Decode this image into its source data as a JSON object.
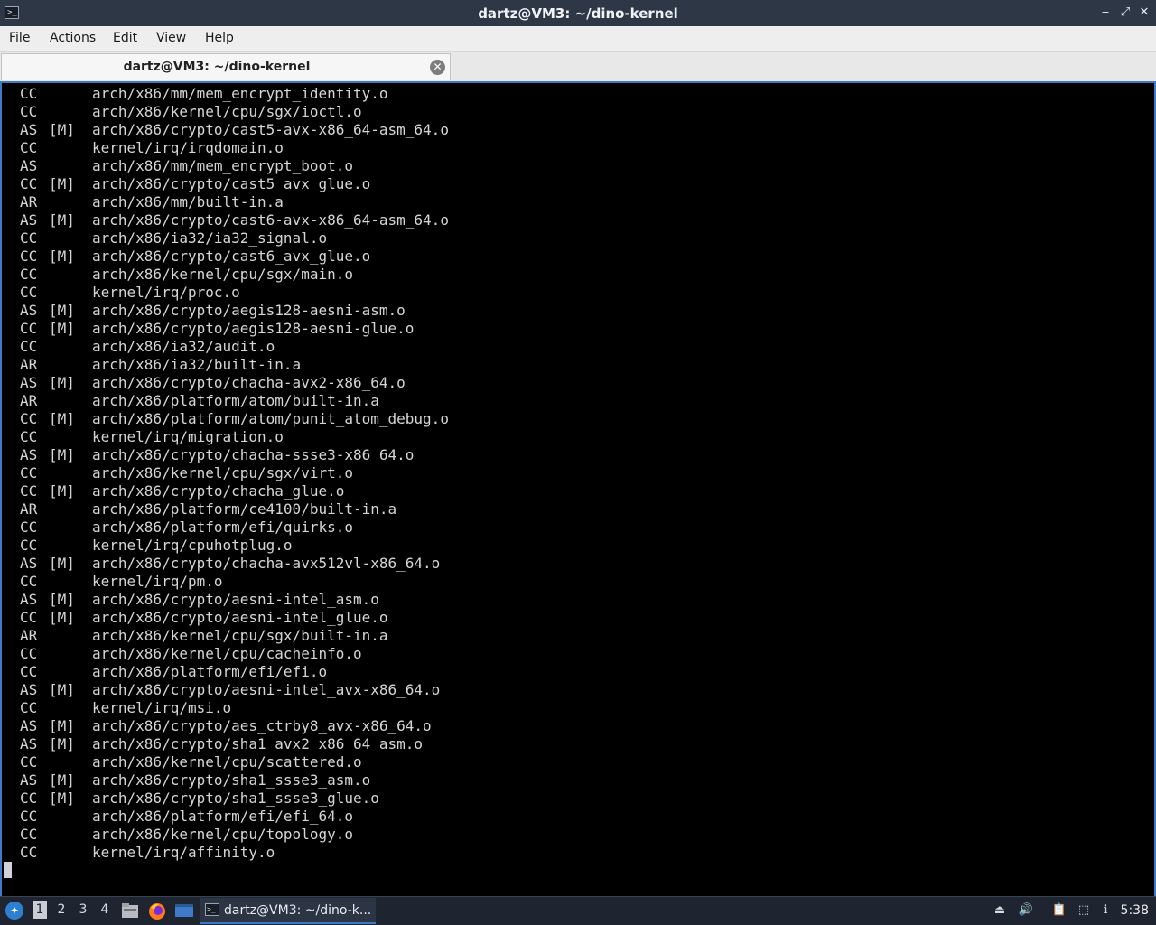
{
  "window": {
    "title": "dartz@VM3: ~/dino-kernel"
  },
  "menubar": {
    "items": [
      "File",
      "Actions",
      "Edit",
      "View",
      "Help"
    ]
  },
  "tab": {
    "label": "dartz@VM3: ~/dino-kernel"
  },
  "terminal": {
    "lines": [
      [
        "CC",
        "",
        "arch/x86/mm/mem_encrypt_identity.o"
      ],
      [
        "CC",
        "",
        "arch/x86/kernel/cpu/sgx/ioctl.o"
      ],
      [
        "AS",
        "[M]",
        "arch/x86/crypto/cast5-avx-x86_64-asm_64.o"
      ],
      [
        "CC",
        "",
        "kernel/irq/irqdomain.o"
      ],
      [
        "AS",
        "",
        "arch/x86/mm/mem_encrypt_boot.o"
      ],
      [
        "CC",
        "[M]",
        "arch/x86/crypto/cast5_avx_glue.o"
      ],
      [
        "AR",
        "",
        "arch/x86/mm/built-in.a"
      ],
      [
        "AS",
        "[M]",
        "arch/x86/crypto/cast6-avx-x86_64-asm_64.o"
      ],
      [
        "CC",
        "",
        "arch/x86/ia32/ia32_signal.o"
      ],
      [
        "CC",
        "[M]",
        "arch/x86/crypto/cast6_avx_glue.o"
      ],
      [
        "CC",
        "",
        "arch/x86/kernel/cpu/sgx/main.o"
      ],
      [
        "CC",
        "",
        "kernel/irq/proc.o"
      ],
      [
        "AS",
        "[M]",
        "arch/x86/crypto/aegis128-aesni-asm.o"
      ],
      [
        "CC",
        "[M]",
        "arch/x86/crypto/aegis128-aesni-glue.o"
      ],
      [
        "CC",
        "",
        "arch/x86/ia32/audit.o"
      ],
      [
        "AR",
        "",
        "arch/x86/ia32/built-in.a"
      ],
      [
        "AS",
        "[M]",
        "arch/x86/crypto/chacha-avx2-x86_64.o"
      ],
      [
        "AR",
        "",
        "arch/x86/platform/atom/built-in.a"
      ],
      [
        "CC",
        "[M]",
        "arch/x86/platform/atom/punit_atom_debug.o"
      ],
      [
        "CC",
        "",
        "kernel/irq/migration.o"
      ],
      [
        "AS",
        "[M]",
        "arch/x86/crypto/chacha-ssse3-x86_64.o"
      ],
      [
        "CC",
        "",
        "arch/x86/kernel/cpu/sgx/virt.o"
      ],
      [
        "CC",
        "[M]",
        "arch/x86/crypto/chacha_glue.o"
      ],
      [
        "AR",
        "",
        "arch/x86/platform/ce4100/built-in.a"
      ],
      [
        "CC",
        "",
        "arch/x86/platform/efi/quirks.o"
      ],
      [
        "CC",
        "",
        "kernel/irq/cpuhotplug.o"
      ],
      [
        "AS",
        "[M]",
        "arch/x86/crypto/chacha-avx512vl-x86_64.o"
      ],
      [
        "CC",
        "",
        "kernel/irq/pm.o"
      ],
      [
        "AS",
        "[M]",
        "arch/x86/crypto/aesni-intel_asm.o"
      ],
      [
        "CC",
        "[M]",
        "arch/x86/crypto/aesni-intel_glue.o"
      ],
      [
        "AR",
        "",
        "arch/x86/kernel/cpu/sgx/built-in.a"
      ],
      [
        "CC",
        "",
        "arch/x86/kernel/cpu/cacheinfo.o"
      ],
      [
        "CC",
        "",
        "arch/x86/platform/efi/efi.o"
      ],
      [
        "AS",
        "[M]",
        "arch/x86/crypto/aesni-intel_avx-x86_64.o"
      ],
      [
        "CC",
        "",
        "kernel/irq/msi.o"
      ],
      [
        "AS",
        "[M]",
        "arch/x86/crypto/aes_ctrby8_avx-x86_64.o"
      ],
      [
        "AS",
        "[M]",
        "arch/x86/crypto/sha1_avx2_x86_64_asm.o"
      ],
      [
        "CC",
        "",
        "arch/x86/kernel/cpu/scattered.o"
      ],
      [
        "AS",
        "[M]",
        "arch/x86/crypto/sha1_ssse3_asm.o"
      ],
      [
        "CC",
        "[M]",
        "arch/x86/crypto/sha1_ssse3_glue.o"
      ],
      [
        "CC",
        "",
        "arch/x86/platform/efi/efi_64.o"
      ],
      [
        "CC",
        "",
        "arch/x86/kernel/cpu/topology.o"
      ],
      [
        "CC",
        "",
        "kernel/irq/affinity.o"
      ]
    ]
  },
  "taskbar": {
    "workspaces": [
      "1",
      "2",
      "3",
      "4"
    ],
    "active_workspace": "1",
    "task_label": "dartz@VM3: ~/dino-k...",
    "clock": "5:38"
  },
  "colors": {
    "accent": "#3d7bc8",
    "terminal_bg": "#000000",
    "terminal_fg": "#d5d5d5",
    "panel_bg": "#1f2530"
  },
  "icons": [
    "terminal-icon",
    "minimize-icon",
    "maximize-icon",
    "close-icon",
    "tab-close-icon",
    "start-menu-icon",
    "file-manager-icon",
    "firefox-icon",
    "desktop-icon",
    "tray-removable-icon",
    "volume-icon",
    "clipboard-icon",
    "network-icon",
    "notification-icon"
  ]
}
